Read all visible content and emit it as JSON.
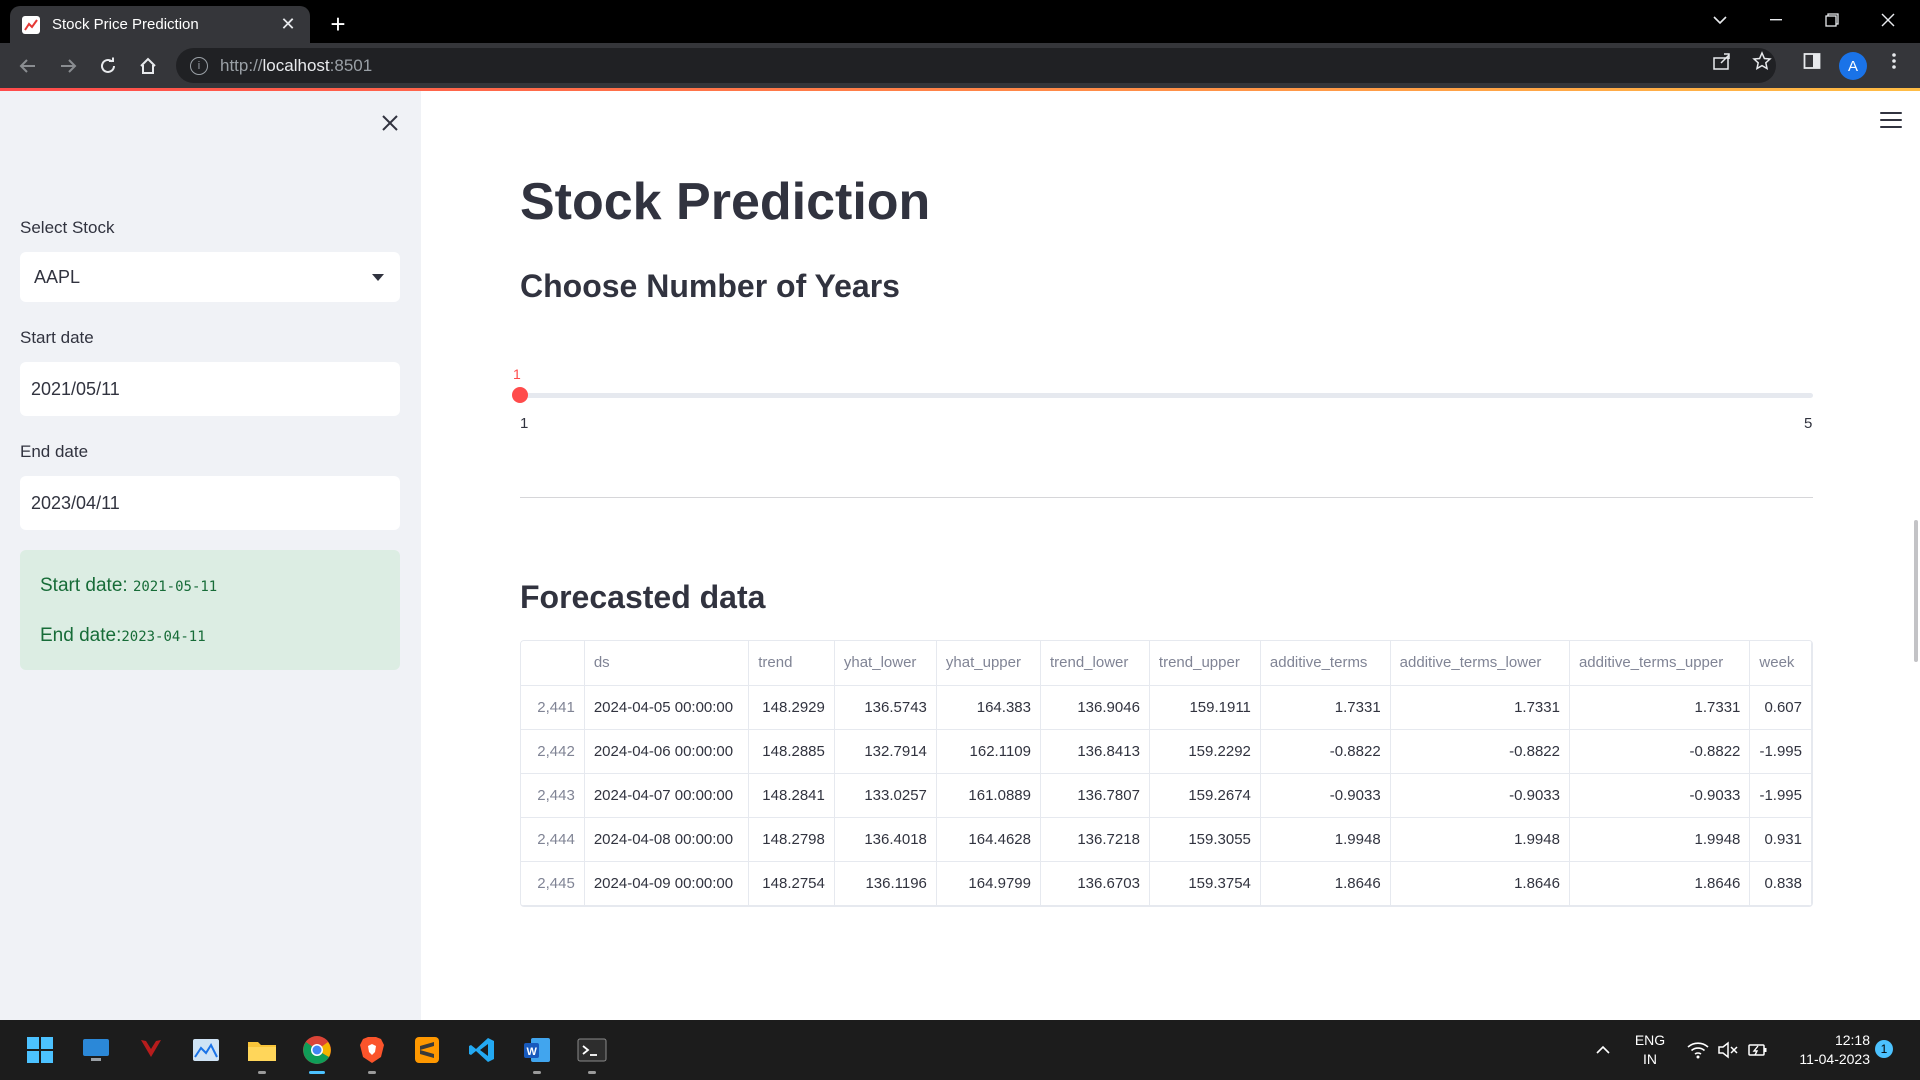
{
  "browser": {
    "tab_title": "Stock Price Prediction",
    "url_scheme": "http://",
    "url_host": "localhost",
    "url_port": ":8501"
  },
  "sidebar": {
    "select_label": "Select Stock",
    "select_value": "AAPL",
    "start_label": "Start date",
    "start_value": "2021/05/11",
    "end_label": "End date",
    "end_value": "2023/04/11",
    "success_start_label": "Start date:",
    "success_start_value": "2021-05-11",
    "success_end_label": "End date:",
    "success_end_value": "2023-04-11"
  },
  "main": {
    "title": "Stock Prediction",
    "years_heading": "Choose Number of Years",
    "slider": {
      "value": "1",
      "min": "1",
      "max": "5",
      "fraction": 0
    },
    "forecast_heading": "Forecasted data"
  },
  "table": {
    "columns": [
      "",
      "ds",
      "trend",
      "yhat_lower",
      "yhat_upper",
      "trend_lower",
      "trend_upper",
      "additive_terms",
      "additive_terms_lower",
      "additive_terms_upper",
      "week"
    ],
    "rows": [
      [
        "2,441",
        "2024-04-05 00:00:00",
        "148.2929",
        "136.5743",
        "164.383",
        "136.9046",
        "159.1911",
        "1.7331",
        "1.7331",
        "1.7331",
        "0.607"
      ],
      [
        "2,442",
        "2024-04-06 00:00:00",
        "148.2885",
        "132.7914",
        "162.1109",
        "136.8413",
        "159.2292",
        "-0.8822",
        "-0.8822",
        "-0.8822",
        "-1.995"
      ],
      [
        "2,443",
        "2024-04-07 00:00:00",
        "148.2841",
        "133.0257",
        "161.0889",
        "136.7807",
        "159.2674",
        "-0.9033",
        "-0.9033",
        "-0.9033",
        "-1.995"
      ],
      [
        "2,444",
        "2024-04-08 00:00:00",
        "148.2798",
        "136.4018",
        "164.4628",
        "136.7218",
        "159.3055",
        "1.9948",
        "1.9948",
        "1.9948",
        "0.931"
      ],
      [
        "2,445",
        "2024-04-09 00:00:00",
        "148.2754",
        "136.1196",
        "164.9799",
        "136.6703",
        "159.3754",
        "1.8646",
        "1.8646",
        "1.8646",
        "0.838"
      ]
    ]
  },
  "taskbar": {
    "lang_1": "ENG",
    "lang_2": "IN",
    "time": "12:18",
    "date": "11-04-2023",
    "notifications": "1"
  },
  "colors": {
    "accent": "#ff4b4b",
    "sidebar_bg": "#f0f2f6",
    "success_bg": "#dcede3",
    "success_text": "#176c38"
  }
}
